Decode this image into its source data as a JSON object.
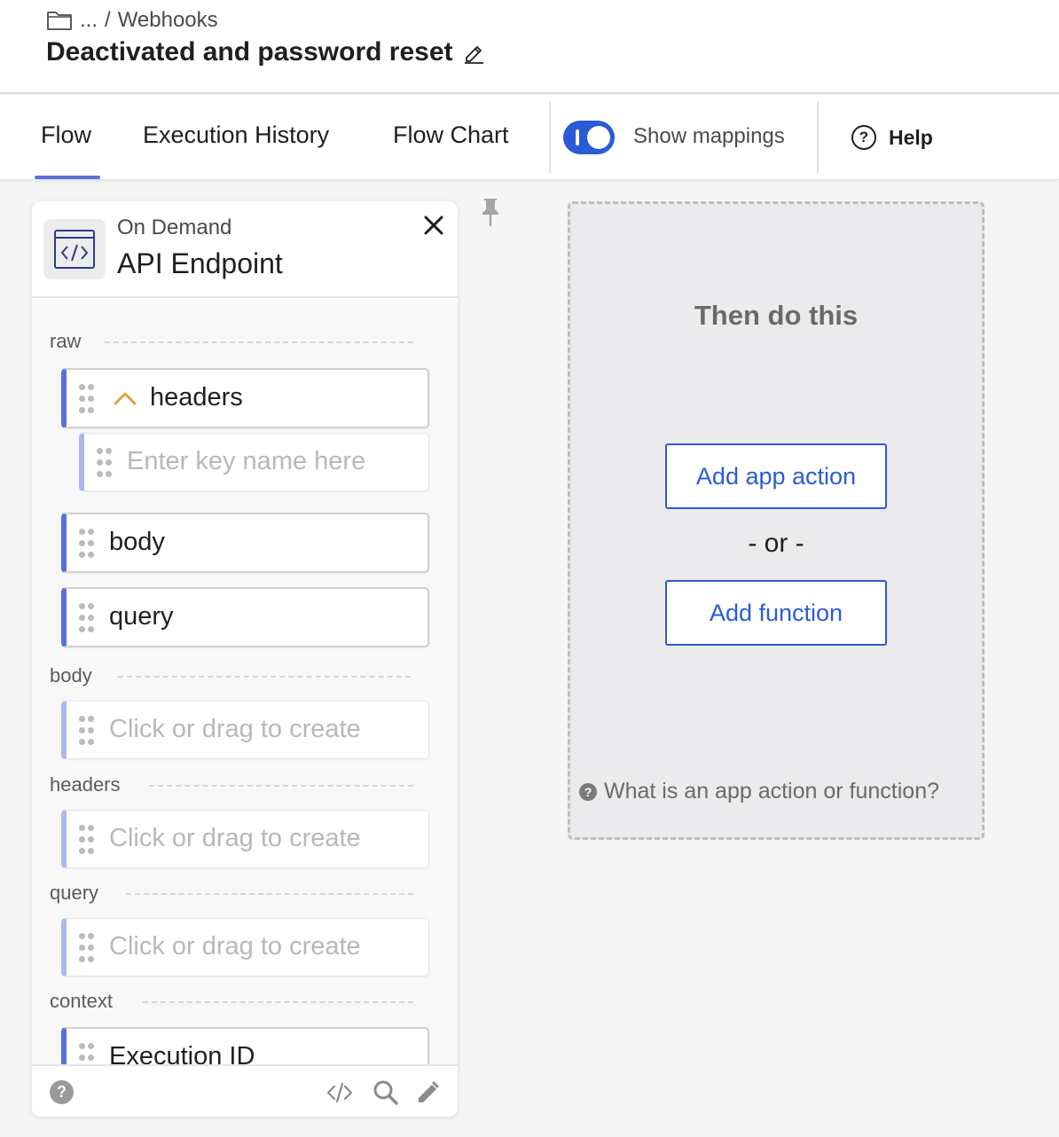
{
  "breadcrumb": {
    "ellipsis": "...",
    "separator": "/",
    "current": "Webhooks"
  },
  "page": {
    "title": "Deactivated and password reset"
  },
  "tabs": [
    {
      "label": "Flow",
      "active": true
    },
    {
      "label": "Execution History",
      "active": false
    },
    {
      "label": "Flow Chart",
      "active": false
    }
  ],
  "toggle": {
    "label": "Show mappings",
    "on": true
  },
  "help": {
    "label": "Help"
  },
  "trigger": {
    "subtitle": "On Demand",
    "title": "API Endpoint",
    "sections": {
      "raw": "raw",
      "body": "body",
      "headers": "headers",
      "query": "query",
      "context": "context"
    },
    "raw_fields": {
      "headers": "headers",
      "key_placeholder": "Enter key name here",
      "body": "body",
      "query": "query"
    },
    "create_placeholder": "Click or drag to create",
    "context_fields": {
      "execution_id": "Execution ID"
    }
  },
  "actions": {
    "title": "Then do this",
    "add_app_action": "Add app action",
    "or": "- or -",
    "add_function": "Add function",
    "help_link": "What is an app action or function?"
  },
  "colors": {
    "accent": "#2a5bd7",
    "field_border": "#5a6fe0",
    "chevron": "#e0a040"
  }
}
